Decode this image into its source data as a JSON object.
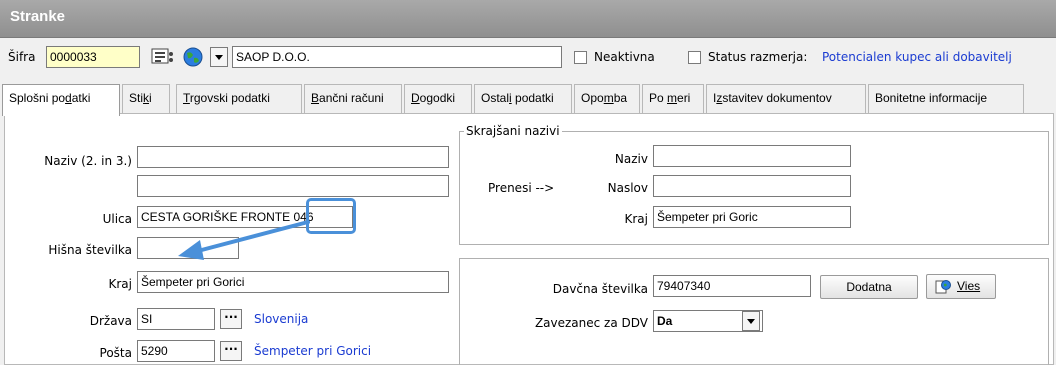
{
  "window": {
    "title": "Stranke"
  },
  "header": {
    "sifra_label": "Šifra",
    "sifra_value": "0000033",
    "company_name": "SAOP D.O.O.",
    "neaktivna_label": "Neaktivna",
    "status_label": "Status razmerja:",
    "status_value": "Potencialen kupec ali dobavitelj"
  },
  "tabs": [
    {
      "pre": "Splošni po",
      "u": "d",
      "post": "atki"
    },
    {
      "pre": "Sti",
      "u": "k",
      "post": "i"
    },
    {
      "pre": "",
      "u": "T",
      "post": "rgovski podatki"
    },
    {
      "pre": "",
      "u": "B",
      "post": "ančni računi"
    },
    {
      "pre": "",
      "u": "D",
      "post": "ogodki"
    },
    {
      "pre": "Ostal",
      "u": "i",
      "post": " podatki"
    },
    {
      "pre": "Opo",
      "u": "m",
      "post": "ba"
    },
    {
      "pre": "Po ",
      "u": "m",
      "post": "eri"
    },
    {
      "pre": "I",
      "u": "z",
      "post": "stavitev dokumentov"
    },
    {
      "pre": "Bonitetne informacije",
      "u": "",
      "post": ""
    }
  ],
  "form": {
    "naziv_label": "Naziv (2. in 3.)",
    "naziv_1": "",
    "naziv_2": "",
    "ulica_label": "Ulica",
    "ulica_value": "CESTA GORIŠKE FRONTE 046",
    "hisna_label": "Hišna številka",
    "hisna_value": "",
    "kraj_label": "Kraj",
    "kraj_value": "Šempeter pri Gorici",
    "drzava_label": "Država",
    "drzava_value": "SI",
    "drzava_name": "Slovenija",
    "posta_label": "Pošta",
    "posta_value": "5290",
    "posta_name": "Šempeter pri Gorici"
  },
  "short_names": {
    "legend": "Skrajšani nazivi",
    "prenesi": "Prenesi -->",
    "naziv_label": "Naziv",
    "naziv_value": "",
    "naslov_label": "Naslov",
    "naslov_value": "",
    "kraj_label": "Kraj",
    "kraj_value": "Šempeter pri Goric"
  },
  "tax": {
    "davcna_label": "Davčna številka",
    "davcna_value": "79407340",
    "dodatna_btn": "Dodatna",
    "vies_btn": "Vies",
    "ddv_label": "Zavezanec za DDV",
    "ddv_value": "Da"
  },
  "colors": {
    "highlight": "#4a90d9",
    "link": "#1a3bd1"
  }
}
